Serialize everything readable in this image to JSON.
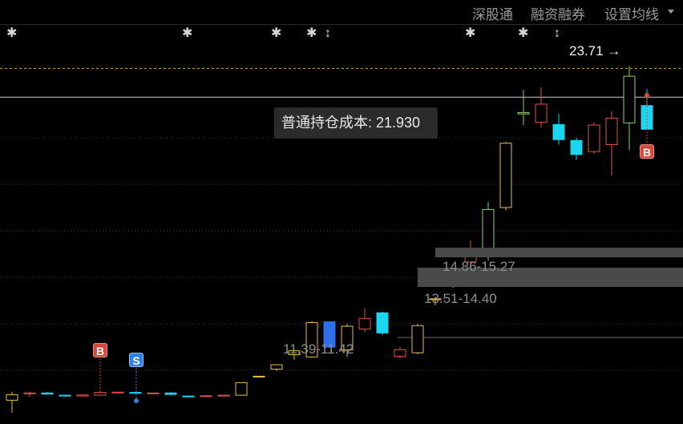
{
  "toolbar": {
    "links": [
      "深股通",
      "融资融券",
      "设置均线"
    ]
  },
  "cost_tooltip": "普通持仓成本: 21.930",
  "price_callout": "23.71 →",
  "cost_ranges": [
    "14.86-15.27",
    "13.51-14.40",
    "11.39-11.42"
  ],
  "badges": {
    "buy": "B",
    "sell": "S"
  },
  "event_glyphs": [
    "✱",
    "✱",
    "✱",
    "✱",
    "↕",
    "✱",
    "✱",
    "↕"
  ],
  "colors": {
    "up": "#e0504a",
    "up_yellow": "#e8c04a",
    "up_green": "#8fd36a",
    "down": "#1ad6f0",
    "down_blue": "#2f6fe8",
    "grid": "#3a3a3a",
    "cost_line": "#d8a040",
    "current_line": "#cfcfcf"
  },
  "chart_data": {
    "type": "candlestick",
    "candles": [
      {
        "o": 10.05,
        "h": 10.35,
        "l": 9.6,
        "c": 10.25,
        "dir": "up",
        "color": "up_yellow"
      },
      {
        "o": 10.28,
        "h": 10.36,
        "l": 10.17,
        "c": 10.31,
        "dir": "up",
        "color": "up"
      },
      {
        "o": 10.31,
        "h": 10.34,
        "l": 10.25,
        "c": 10.27,
        "dir": "down",
        "color": "down"
      },
      {
        "o": 10.23,
        "h": 10.25,
        "l": 10.18,
        "c": 10.2,
        "dir": "down",
        "color": "down"
      },
      {
        "o": 10.2,
        "h": 10.26,
        "l": 10.18,
        "c": 10.24,
        "dir": "up",
        "color": "up"
      },
      {
        "o": 10.23,
        "h": 10.4,
        "l": 10.21,
        "c": 10.33,
        "dir": "up",
        "color": "up"
      },
      {
        "o": 10.33,
        "h": 10.35,
        "l": 10.3,
        "c": 10.34,
        "dir": "up",
        "color": "up"
      },
      {
        "o": 10.33,
        "h": 10.35,
        "l": 10.28,
        "c": 10.3,
        "dir": "down",
        "color": "down"
      },
      {
        "o": 10.3,
        "h": 10.32,
        "l": 10.28,
        "c": 10.31,
        "dir": "up",
        "color": "up"
      },
      {
        "o": 10.31,
        "h": 10.34,
        "l": 10.24,
        "c": 10.26,
        "dir": "down",
        "color": "down"
      },
      {
        "o": 10.2,
        "h": 10.22,
        "l": 10.18,
        "c": 10.19,
        "dir": "down",
        "color": "down"
      },
      {
        "o": 10.19,
        "h": 10.22,
        "l": 10.16,
        "c": 10.21,
        "dir": "up",
        "color": "up"
      },
      {
        "o": 10.21,
        "h": 10.24,
        "l": 10.2,
        "c": 10.23,
        "dir": "up",
        "color": "up"
      },
      {
        "o": 10.23,
        "h": 10.68,
        "l": 10.22,
        "c": 10.68,
        "dir": "up",
        "color": "up_yellow"
      },
      {
        "o": 10.9,
        "h": 10.92,
        "l": 10.9,
        "c": 10.91,
        "dir": "up",
        "color": "up_yellow"
      },
      {
        "o": 11.16,
        "h": 11.3,
        "l": 11.1,
        "c": 11.32,
        "dir": "up",
        "color": "up_yellow"
      },
      {
        "o": 11.68,
        "h": 11.85,
        "l": 11.5,
        "c": 11.82,
        "dir": "up",
        "color": "up_yellow"
      },
      {
        "o": 11.6,
        "h": 12.88,
        "l": 11.58,
        "c": 12.83,
        "dir": "up",
        "color": "up_yellow"
      },
      {
        "o": 12.86,
        "h": 12.86,
        "l": 11.95,
        "c": 11.95,
        "dir": "down",
        "color": "down_blue"
      },
      {
        "o": 11.85,
        "h": 12.78,
        "l": 11.6,
        "c": 12.7,
        "dir": "up",
        "color": "up_yellow"
      },
      {
        "o": 12.6,
        "h": 13.35,
        "l": 12.5,
        "c": 12.98,
        "dir": "up",
        "color": "up"
      },
      {
        "o": 13.18,
        "h": 13.22,
        "l": 12.38,
        "c": 12.46,
        "dir": "down",
        "color": "down"
      },
      {
        "o": 11.62,
        "h": 11.95,
        "l": 11.55,
        "c": 11.86,
        "dir": "up",
        "color": "up"
      },
      {
        "o": 11.75,
        "h": 12.78,
        "l": 11.7,
        "c": 12.72,
        "dir": "up",
        "color": "up_yellow"
      },
      {
        "o": 13.65,
        "h": 13.7,
        "l": 13.45,
        "c": 13.68,
        "dir": "up",
        "color": "up_yellow"
      },
      {
        "o": 14.12,
        "h": 14.55,
        "l": 14.08,
        "c": 14.5,
        "dir": "up",
        "color": "up_yellow"
      },
      {
        "o": 15.0,
        "h": 15.78,
        "l": 14.4,
        "c": 15.3,
        "dir": "up",
        "color": "up"
      },
      {
        "o": 15.4,
        "h": 17.15,
        "l": 15.05,
        "c": 16.88,
        "dir": "up",
        "color": "up_green"
      },
      {
        "o": 16.95,
        "h": 19.3,
        "l": 16.85,
        "c": 19.25,
        "dir": "up",
        "color": "up_yellow"
      },
      {
        "o": 20.3,
        "h": 21.15,
        "l": 19.9,
        "c": 20.35,
        "dir": "up",
        "color": "up_green"
      },
      {
        "o": 20.0,
        "h": 21.25,
        "l": 19.8,
        "c": 20.65,
        "dir": "up",
        "color": "up"
      },
      {
        "o": 19.92,
        "h": 20.3,
        "l": 19.2,
        "c": 19.38,
        "dir": "down",
        "color": "down"
      },
      {
        "o": 19.35,
        "h": 19.45,
        "l": 18.65,
        "c": 18.85,
        "dir": "down",
        "color": "down"
      },
      {
        "o": 18.95,
        "h": 20.0,
        "l": 18.88,
        "c": 19.9,
        "dir": "up",
        "color": "up"
      },
      {
        "o": 19.2,
        "h": 20.4,
        "l": 18.1,
        "c": 20.15,
        "dir": "up",
        "color": "up"
      },
      {
        "o": 19.98,
        "h": 22.02,
        "l": 19.0,
        "c": 21.65,
        "dir": "up",
        "color": "up_green"
      },
      {
        "o": 20.6,
        "h": 21.2,
        "l": 19.9,
        "c": 19.75,
        "dir": "down",
        "color": "down"
      }
    ],
    "price_range": [
      9.4,
      22.6
    ],
    "cost_price": 21.93,
    "current_price_line": 20.9,
    "grid": true
  }
}
